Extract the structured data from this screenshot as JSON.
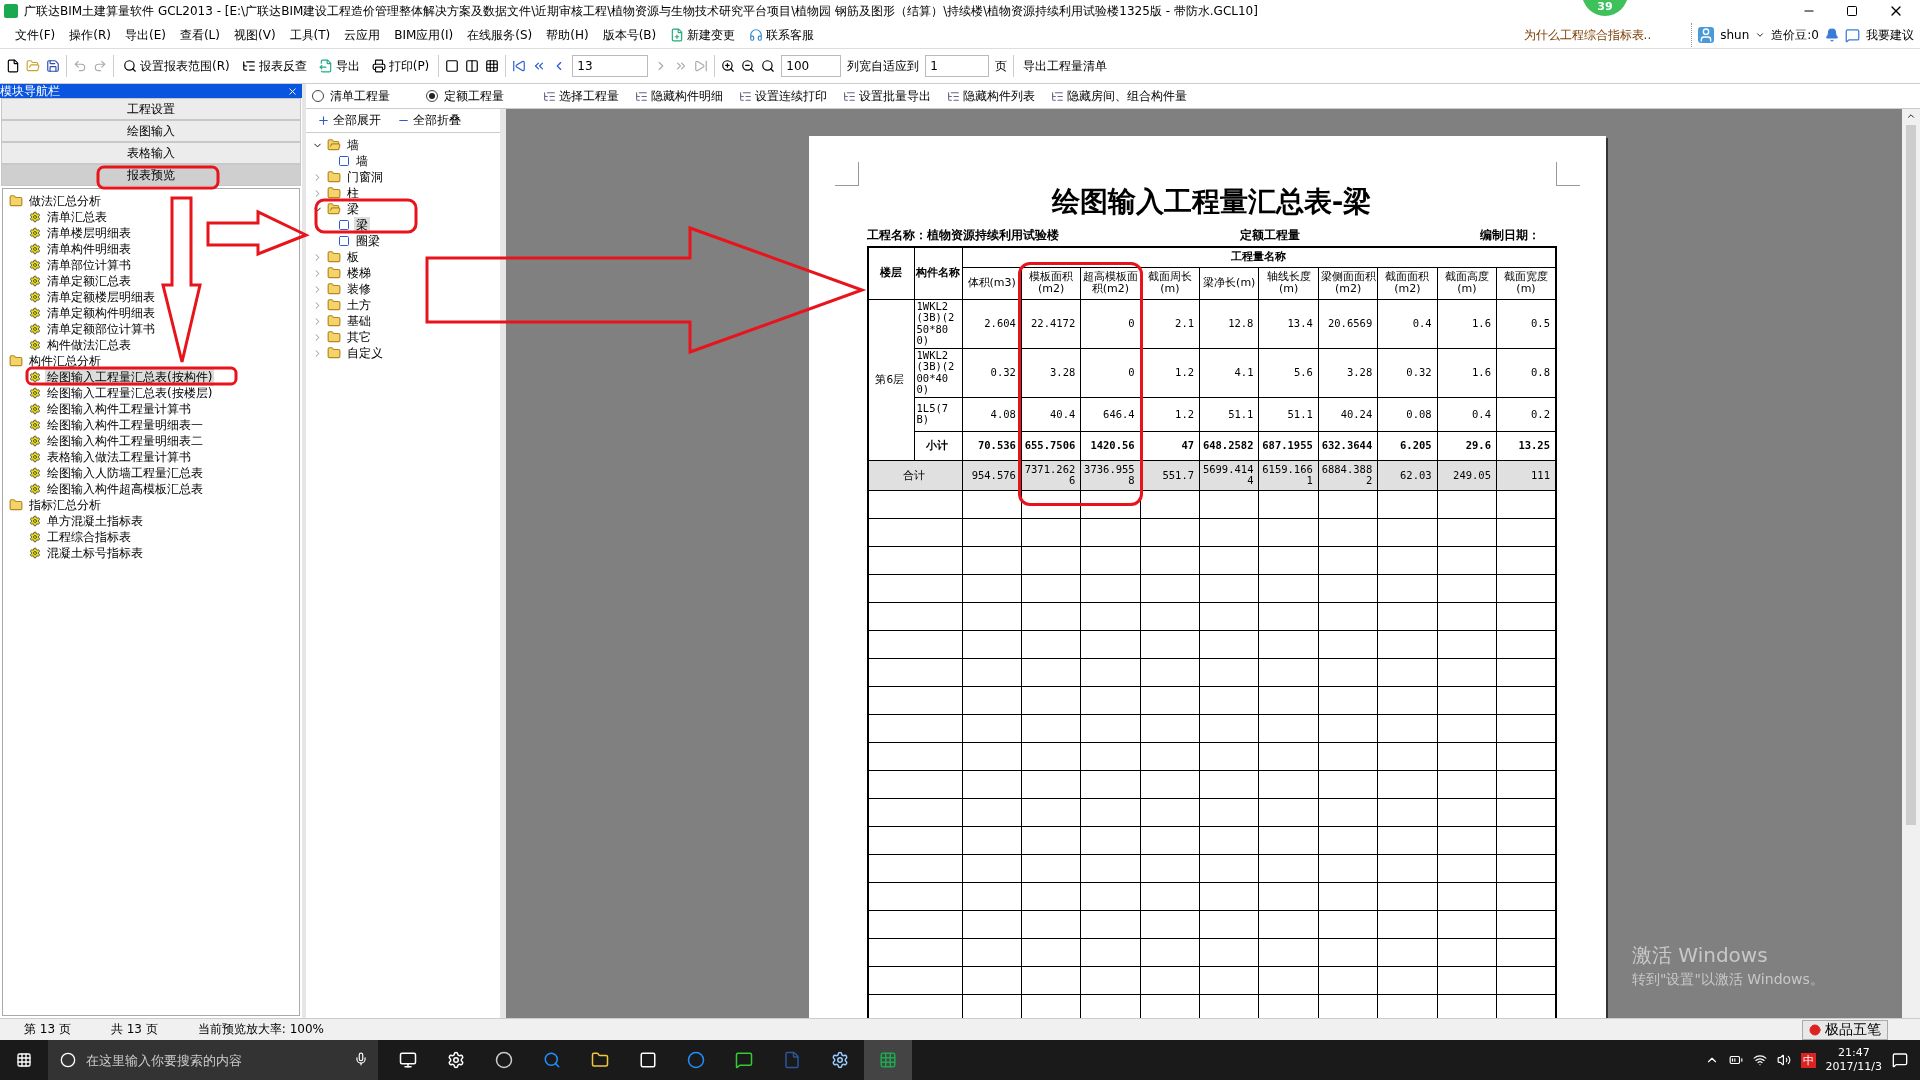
{
  "window": {
    "title": "广联达BIM土建算量软件 GCL2013 - [E:\\广联达BIM建设工程造价管理整体解决方案及数据文件\\近期审核工程\\植物资源与生物技术研究平台项目\\植物园 钢筋及图形（结算）\\持续楼\\植物资源持续利用试验楼1325版 - 带防水.GCL10]"
  },
  "notification_badge": "39",
  "menu": [
    "文件(F)",
    "操作(R)",
    "导出(E)",
    "查看(L)",
    "视图(V)",
    "工具(T)",
    "云应用",
    "BIM应用(I)",
    "在线服务(S)",
    "帮助(H)",
    "版本号(B)",
    "新建变更",
    "联系客服"
  ],
  "tip": "为什么工程综合指标表..",
  "user": {
    "name": "shun",
    "beans": "造价豆:0",
    "feedback": "我要建议"
  },
  "toolbar": {
    "buttons": [
      "设置报表范围(R)",
      "报表反查",
      "导出",
      "打印(P)"
    ],
    "page": "13",
    "zoom": "100",
    "fit_label": "列宽自适应到",
    "fit_value": "1",
    "page_unit": "页",
    "export": "导出工程量清单"
  },
  "navigator": {
    "title": "模块导航栏",
    "sections": [
      {
        "label": "工程设置",
        "selected": false
      },
      {
        "label": "绘图输入",
        "selected": false
      },
      {
        "label": "表格输入",
        "selected": false
      },
      {
        "label": "报表预览",
        "selected": true
      }
    ],
    "tree": [
      {
        "label": "做法汇总分析",
        "children": [
          {
            "label": "清单汇总表",
            "selected": false
          },
          {
            "label": "清单楼层明细表",
            "selected": false
          },
          {
            "label": "清单构件明细表",
            "selected": false
          },
          {
            "label": "清单部位计算书",
            "selected": false
          },
          {
            "label": "清单定额汇总表",
            "selected": false
          },
          {
            "label": "清单定额楼层明细表",
            "selected": false
          },
          {
            "label": "清单定额构件明细表",
            "selected": false
          },
          {
            "label": "清单定额部位计算书",
            "selected": false
          },
          {
            "label": "构件做法汇总表",
            "selected": false
          }
        ]
      },
      {
        "label": "构件汇总分析",
        "children": [
          {
            "label": "绘图输入工程量汇总表(按构件)",
            "selected": true
          },
          {
            "label": "绘图输入工程量汇总表(按楼层)",
            "selected": false
          },
          {
            "label": "绘图输入构件工程量计算书",
            "selected": false
          },
          {
            "label": "绘图输入构件工程量明细表一",
            "selected": false
          },
          {
            "label": "绘图输入构件工程量明细表二",
            "selected": false
          },
          {
            "label": "表格输入做法工程量计算书",
            "selected": false
          },
          {
            "label": "绘图输入人防墙工程量汇总表",
            "selected": false
          },
          {
            "label": "绘图输入构件超高模板汇总表",
            "selected": false
          }
        ]
      },
      {
        "label": "指标汇总分析",
        "children": [
          {
            "label": "单方混凝土指标表",
            "selected": false
          },
          {
            "label": "工程综合指标表",
            "selected": false
          },
          {
            "label": "混凝土标号指标表",
            "selected": false
          }
        ]
      }
    ]
  },
  "quantity_mode": [
    {
      "label": "清单工程量",
      "selected": false
    },
    {
      "label": "定额工程量",
      "selected": true
    }
  ],
  "options": [
    "选择工程量",
    "隐藏构件明细",
    "设置连续打印",
    "设置批量导出",
    "隐藏构件列表",
    "隐藏房间、组合构件量"
  ],
  "component_tree": {
    "expand_all": "全部展开",
    "collapse_all": "全部折叠",
    "items": [
      {
        "label": "墙",
        "expanded": true,
        "children": [
          {
            "label": "墙",
            "selected": false
          }
        ]
      },
      {
        "label": "门窗洞",
        "expanded": false
      },
      {
        "label": "柱",
        "expanded": false
      },
      {
        "label": "梁",
        "expanded": true,
        "children": [
          {
            "label": "梁",
            "selected": true
          },
          {
            "label": "圈梁",
            "selected": false
          }
        ]
      },
      {
        "label": "板",
        "expanded": false
      },
      {
        "label": "楼梯",
        "expanded": false
      },
      {
        "label": "装修",
        "expanded": false
      },
      {
        "label": "土方",
        "expanded": false
      },
      {
        "label": "基础",
        "expanded": false
      },
      {
        "label": "其它",
        "expanded": false
      },
      {
        "label": "自定义",
        "expanded": false
      }
    ]
  },
  "report": {
    "title": "绘图输入工程量汇总表-梁",
    "project": "工程名称：植物资源持续利用试验楼",
    "mode": "定额工程量",
    "date_label": "编制日期：",
    "floor_header": "楼层",
    "component_header": "构件名称",
    "group_header": "工程量名称",
    "quantities": [
      "体积(m3)",
      "模板面积(m2)",
      "超高模板面积(m2)",
      "截面周长(m)",
      "梁净长(m)",
      "轴线长度(m)",
      "梁侧面面积(m2)",
      "截面面积(m2)",
      "截面高度(m)",
      "截面宽度(m)"
    ],
    "floor": "第6层",
    "rows": [
      {
        "component": "1WKL2(3B)(250*800)",
        "values": [
          "2.604",
          "22.4172",
          "0",
          "2.1",
          "12.8",
          "13.4",
          "20.6569",
          "0.4",
          "1.6",
          "0.5"
        ]
      },
      {
        "component": "1WKL2(3B)(200*400)",
        "values": [
          "0.32",
          "3.28",
          "0",
          "1.2",
          "4.1",
          "5.6",
          "3.28",
          "0.32",
          "1.6",
          "0.8"
        ]
      },
      {
        "component": "1L5(7B)",
        "values": [
          "4.08",
          "40.4",
          "646.4",
          "1.2",
          "51.1",
          "51.1",
          "40.24",
          "0.08",
          "0.4",
          "0.2"
        ]
      }
    ],
    "subtotal": {
      "label": "小计",
      "values": [
        "70.536",
        "655.7506",
        "1420.56",
        "47",
        "648.2582",
        "687.1955",
        "632.3644",
        "6.205",
        "29.6",
        "13.25"
      ]
    },
    "total": {
      "label": "合计",
      "values": [
        "954.576",
        "7371.2626",
        "3736.9558",
        "551.7",
        "5699.4144",
        "6159.1661",
        "6884.3882",
        "62.03",
        "249.05",
        "111"
      ]
    }
  },
  "status_bar": {
    "page": "第 13 页",
    "total": "共 13 页",
    "zoom": "当前预览放大率: 100%"
  },
  "activation_notice": {
    "title": "激活 Windows",
    "hint": "转到\"设置\"以激活 Windows。"
  },
  "ime": {
    "label": "极品五笔"
  },
  "taskbar": {
    "search_placeholder": "在这里输入你要搜索的内容",
    "ime_indicator": "中",
    "time": "21:47",
    "date": "2017/11/3"
  }
}
